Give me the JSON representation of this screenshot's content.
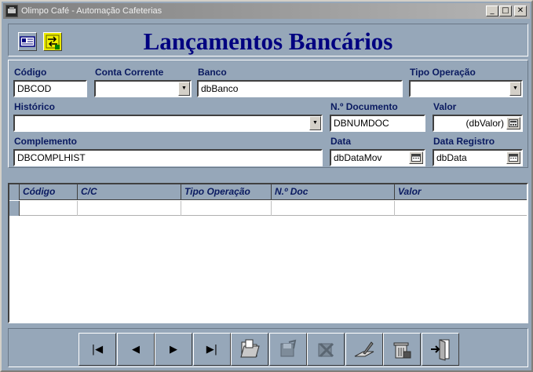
{
  "window": {
    "title": "Olimpo Café - Automação Cafeterias",
    "minimize": "_",
    "maximize": "□",
    "close": "✕"
  },
  "header": {
    "title": "Lançamentos Bancários"
  },
  "form": {
    "codigo": {
      "label": "Código",
      "value": "DBCOD"
    },
    "conta_corrente": {
      "label": "Conta Corrente",
      "value": ""
    },
    "banco": {
      "label": "Banco",
      "value": "dbBanco"
    },
    "tipo_operacao": {
      "label": "Tipo Operação",
      "value": ""
    },
    "historico": {
      "label": "Histórico",
      "value": ""
    },
    "num_documento": {
      "label": "N.º Documento",
      "value": "DBNUMDOC"
    },
    "valor": {
      "label": "Valor",
      "value": "(dbValor)"
    },
    "complemento": {
      "label": "Complemento",
      "value": "DBCOMPLHIST"
    },
    "data": {
      "label": "Data",
      "value": "dbDataMov"
    },
    "data_registro": {
      "label": "Data Registro",
      "value": "dbData"
    }
  },
  "grid": {
    "columns": [
      "Código",
      "C/C",
      "Tipo Operação",
      "N.º Doc",
      "Valor"
    ],
    "rows": [
      [
        "",
        "",
        "",
        "",
        ""
      ]
    ]
  },
  "nav": {
    "first": "|◀",
    "prev": "◀",
    "next": "▶",
    "last": "▶|"
  },
  "icons": {
    "toolbar": [
      "card-icon",
      "transfer-icon"
    ],
    "nav": [
      "first-record-icon",
      "previous-record-icon",
      "next-record-icon",
      "last-record-icon",
      "open-folder-icon",
      "save-icon",
      "cancel-icon",
      "edit-icon",
      "delete-icon",
      "exit-door-icon"
    ]
  }
}
